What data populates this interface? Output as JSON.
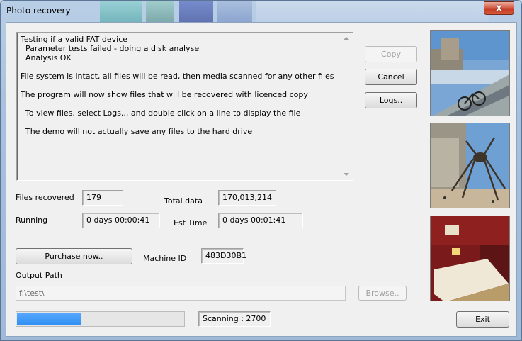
{
  "window": {
    "title": "Photo recovery",
    "close_glyph": "x"
  },
  "log": {
    "lines": [
      "Testing if a valid FAT device",
      "  Parameter tests failed - doing a disk analyse",
      "  Analysis OK",
      "File system is intact, all files will be read, then media scanned for any other files",
      "The program will now show files that will be recovered with licenced copy",
      "  To view files, select Logs.., and double click on a line to display the file",
      "  The demo will not actually save any files to the hard drive"
    ]
  },
  "buttons": {
    "copy": "Copy",
    "cancel": "Cancel",
    "logs": "Logs..",
    "purchase": "Purchase now..",
    "browse": "Browse..",
    "exit": "Exit"
  },
  "stats": {
    "files_recovered_label": "Files recovered",
    "files_recovered_value": "179",
    "total_data_label": "Total data",
    "total_data_value": "170,013,214",
    "running_label": "Running",
    "running_value": "0 days 00:00:41",
    "est_time_label": "Est Time",
    "est_time_value": "0 days 00:01:41"
  },
  "machine": {
    "label": "Machine ID",
    "value": "483D30B1"
  },
  "output": {
    "label": "Output Path",
    "value": "f:\\test\\"
  },
  "progress": {
    "fraction": 0.39,
    "status": "Scanning : 2700"
  },
  "colors": {
    "progress": "#2f8ff2",
    "close": "#c33a22"
  },
  "photos": [
    "bicycle-riverside-photo",
    "spider-sculpture-photo",
    "hotel-room-photo"
  ]
}
